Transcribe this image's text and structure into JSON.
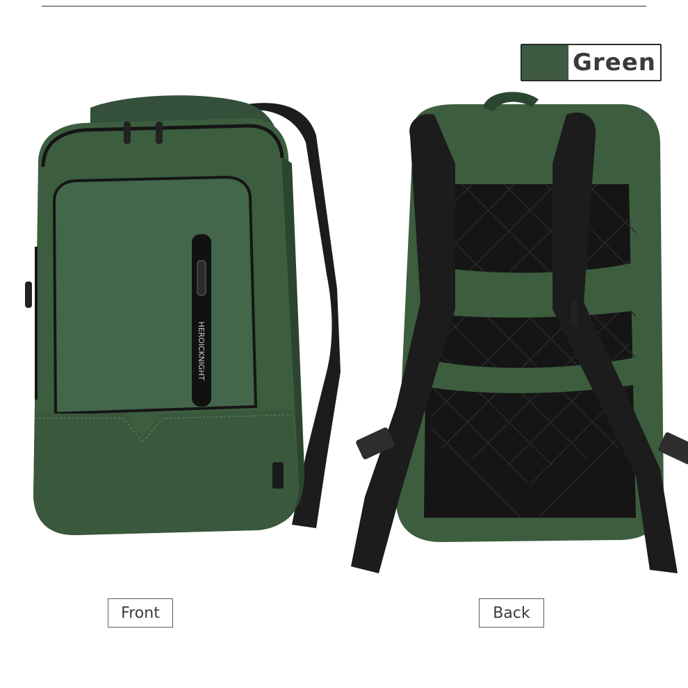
{
  "color_option": {
    "name": "Green",
    "swatch_color": "#3f5a43"
  },
  "views": {
    "front_label": "Front",
    "back_label": "Back"
  },
  "product": {
    "brand_text": "HEROICKNIGHT",
    "body_color": "#3d5d3f",
    "strap_color": "#1c1c1c",
    "panel_color": "#151515"
  }
}
